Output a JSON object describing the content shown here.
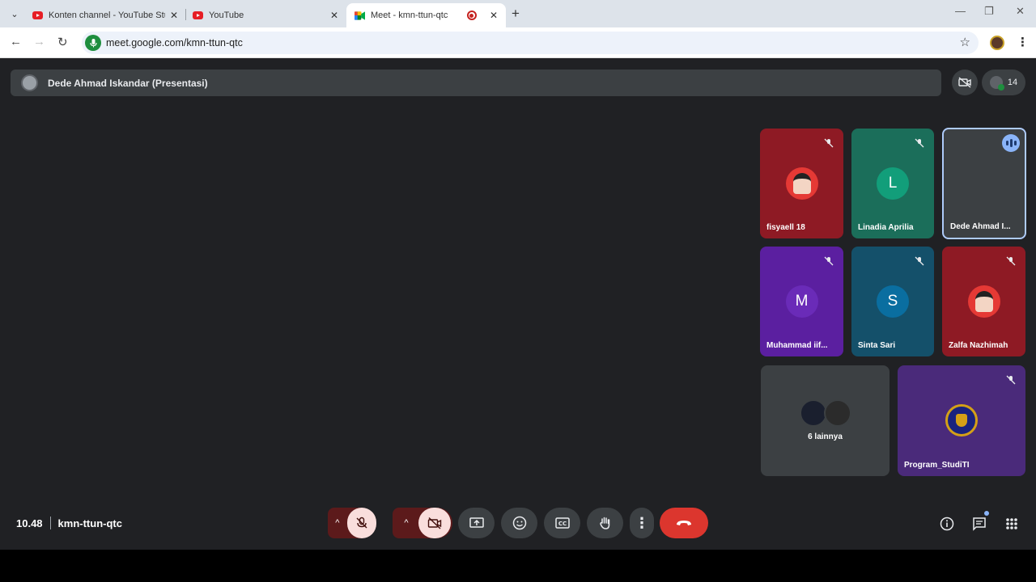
{
  "browser": {
    "tabs": [
      {
        "title": "Konten channel - YouTube Stud"
      },
      {
        "title": "YouTube"
      },
      {
        "title": "Meet - kmn-ttun-qtc"
      }
    ],
    "url": "meet.google.com/kmn-ttun-qtc"
  },
  "meet": {
    "presenter": "Dede Ahmad Iskandar (Presentasi)",
    "participant_count": "14",
    "tiles": [
      {
        "name": "fisyaell 18",
        "initial": "",
        "color": "#8e1a24"
      },
      {
        "name": "Linadia Aprilia",
        "initial": "L",
        "color": "#1b6e5a"
      },
      {
        "name": "Dede Ahmad I...",
        "initial": "",
        "color": "#3c4043"
      },
      {
        "name": "Muhammad iif...",
        "initial": "M",
        "color": "#5b1fa0"
      },
      {
        "name": "Sinta Sari",
        "initial": "S",
        "color": "#14506a"
      },
      {
        "name": "Zalfa Nazhimah",
        "initial": "",
        "color": "#8e1a24"
      },
      {
        "name": "6 lainnya",
        "initial": "",
        "color": "#3c4043"
      },
      {
        "name": "Program_StudiTI",
        "initial": "",
        "color": "#4a2a7a"
      }
    ],
    "time": "10.48",
    "meeting_code": "kmn-ttun-qtc"
  }
}
